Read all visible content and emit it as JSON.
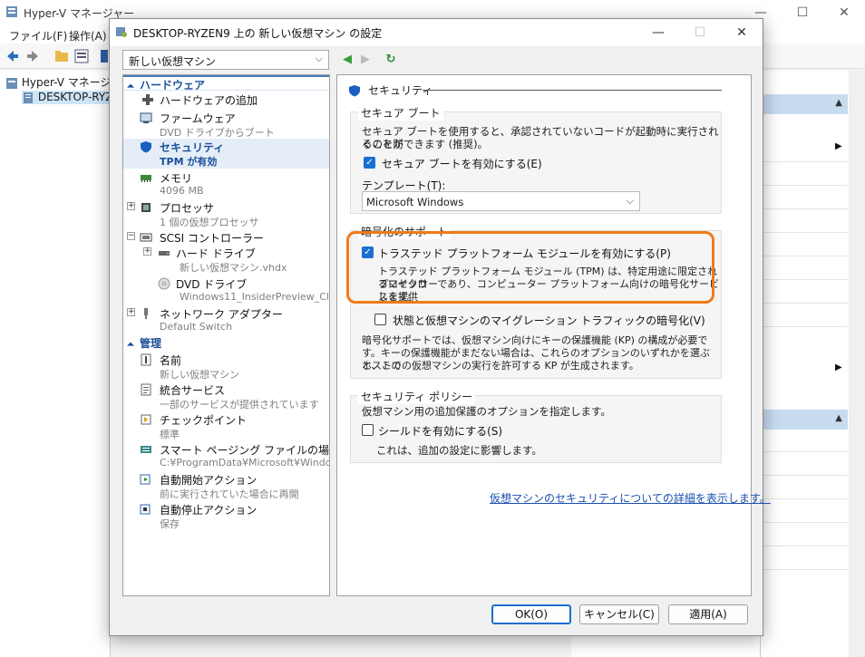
{
  "background": {
    "title": "Hyper-V マネージャー",
    "menus": [
      "ファイル(F)",
      "操作(A)"
    ],
    "tree": [
      "Hyper-V マネージャー",
      "DESKTOP-RYZ"
    ]
  },
  "dialog": {
    "title": "DESKTOP-RYZEN9 上の 新しい仮想マシン の設定",
    "vm_selector": "新しい仮想マシン",
    "hardware_header": "ハードウェア",
    "management_header": "管理",
    "hardware_items": [
      {
        "label": "ハードウェアの追加",
        "sub": ""
      },
      {
        "label": "ファームウェア",
        "sub": "DVD ドライブからブート"
      },
      {
        "label": "セキュリティ",
        "sub": "TPM が有効"
      },
      {
        "label": "メモリ",
        "sub": "4096 MB"
      },
      {
        "label": "プロセッサ",
        "sub": "1 個の仮想プロセッサ"
      },
      {
        "label": "SCSI コントローラー",
        "sub": ""
      },
      {
        "label": "ハード ドライブ",
        "sub": "新しい仮想マシン.vhdx"
      },
      {
        "label": "DVD ドライブ",
        "sub": "Windows11_InsiderPreview_Cl..."
      },
      {
        "label": "ネットワーク アダプター",
        "sub": "Default Switch"
      }
    ],
    "management_items": [
      {
        "label": "名前",
        "sub": "新しい仮想マシン"
      },
      {
        "label": "統合サービス",
        "sub": "一部のサービスが提供されています"
      },
      {
        "label": "チェックポイント",
        "sub": "標準"
      },
      {
        "label": "スマート ページング ファイルの場所",
        "sub": "C:¥ProgramData¥Microsoft¥Windo..."
      },
      {
        "label": "自動開始アクション",
        "sub": "前に実行されていた場合に再開"
      },
      {
        "label": "自動停止アクション",
        "sub": "保存"
      }
    ],
    "content": {
      "section_title": "セキュリティ",
      "secure_boot": {
        "group": "セキュア ブート",
        "desc1": "セキュア ブートを使用すると、承認されていないコードが起動時に実行されるのを防",
        "desc2": "ぐことができます (推奨)。",
        "enable_label": "セキュア ブートを有効にする(E)",
        "enabled": true,
        "template_label": "テンプレート(T):",
        "template_value": "Microsoft Windows"
      },
      "encryption": {
        "group": "暗号化のサポート",
        "tpm_label": "トラステッド プラットフォーム モジュールを有効にする(P)",
        "tpm_enabled": true,
        "tpm_desc1": "トラステッド プラットフォーム モジュール (TPM) は、特定用途に限定されるマイクロ",
        "tpm_desc2": "プロセッサーであり、コンピューター プラットフォーム向けの暗号化サービスを提供",
        "tpm_desc3": "します。",
        "migration_label": "状態と仮想マシンのマイグレーション トラフィックの暗号化(V)",
        "migration_enabled": false,
        "kp_desc1": "暗号化サポートでは、仮想マシン向けにキーの保護機能 (KP) の構成が必要で",
        "kp_desc2": "す。キーの保護機能がまだない場合は、これらのオプションのいずれかを選ぶと、この",
        "kp_desc3": "ホストでの仮想マシンの実行を許可する KP が生成されます。"
      },
      "policy": {
        "group": "セキュリティ ポリシー",
        "desc": "仮想マシン用の追加保護のオプションを指定します。",
        "shield_label": "シールドを有効にする(S)",
        "shield_enabled": false,
        "shield_note": "これは、追加の設定に影響します。"
      },
      "link": "仮想マシンのセキュリティについての詳細を表示します。"
    },
    "buttons": {
      "ok": "OK(O)",
      "cancel": "キャンセル(C)",
      "apply": "適用(A)"
    }
  },
  "colors": {
    "accent": "#1a6fd1",
    "highlight": "#f07a1a",
    "section": "#1b4f9a"
  }
}
